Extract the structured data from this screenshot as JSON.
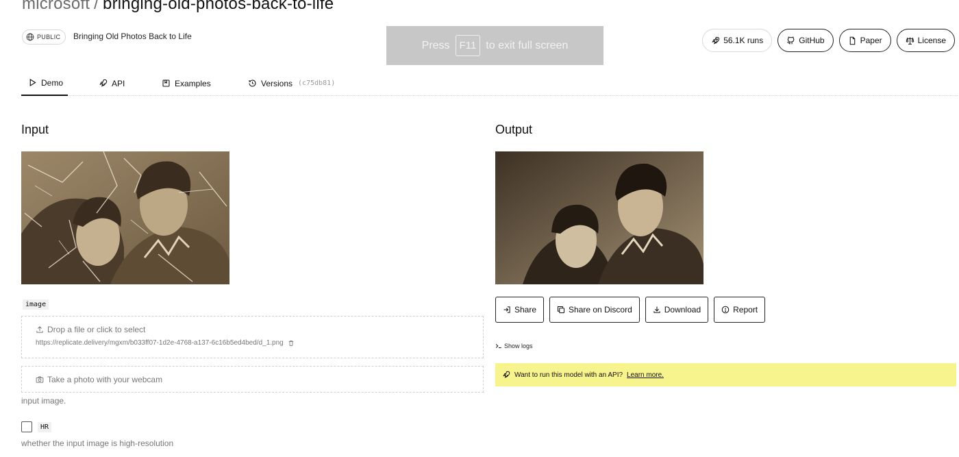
{
  "repo": {
    "owner": "microsoft",
    "separator": "/",
    "name": "bringing-old-photos-back-to-life"
  },
  "visibility": "PUBLIC",
  "description": "Bringing Old Photos Back to Life",
  "fullscreen_notice": {
    "press": "Press",
    "key": "F11",
    "suffix": "to exit full screen"
  },
  "top_buttons": {
    "runs": "56.1K runs",
    "github": "GitHub",
    "paper": "Paper",
    "license": "License"
  },
  "tabs": [
    {
      "label": "Demo",
      "icon": "play-icon",
      "active": true
    },
    {
      "label": "API",
      "icon": "rocket-icon"
    },
    {
      "label": "Examples",
      "icon": "book-icon"
    },
    {
      "label": "Versions",
      "icon": "history-icon",
      "hash": "(c75db81)"
    }
  ],
  "input": {
    "heading": "Input",
    "image_field": {
      "tag": "image",
      "drop_label": "Drop a file or click to select",
      "url": "https://replicate.delivery/mgxm/b033ff07-1d2e-4768-a137-6c16b5ed4bed/d_1.png",
      "webcam_label": "Take a photo with your webcam",
      "hint": "input image."
    },
    "hr_field": {
      "tag": "HR",
      "checked": false,
      "hint": "whether the input image is high-resolution"
    }
  },
  "output": {
    "heading": "Output",
    "buttons": {
      "share": "Share",
      "discord": "Share on Discord",
      "download": "Download",
      "report": "Report"
    },
    "show_logs": "Show logs",
    "api_banner": {
      "text": "Want to run this model with an API?",
      "link": "Learn more."
    }
  },
  "colors": {
    "banner": "#f7f38d",
    "notice_bg": "#c7c7c7",
    "sepia_light": "#8a7456",
    "sepia_dark": "#2e2419"
  }
}
